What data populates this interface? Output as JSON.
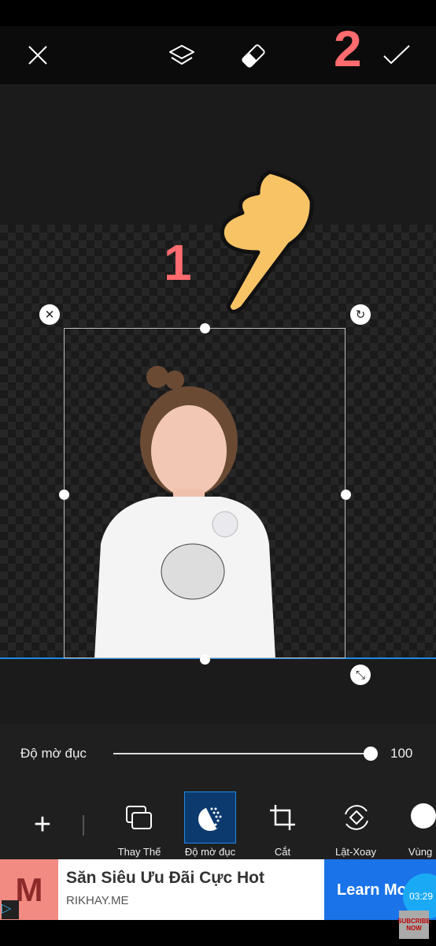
{
  "toolbar": {
    "close": "close-icon",
    "layers": "layers-icon",
    "eraser": "eraser-icon",
    "apply": "check-icon"
  },
  "annotations": {
    "step1": "1",
    "step2": "2"
  },
  "opacity": {
    "label": "Độ mờ đục",
    "value": "100",
    "percent": 100
  },
  "tools": [
    {
      "label": "Thay Thế",
      "icon": "replace-icon"
    },
    {
      "label": "Độ mờ đục",
      "icon": "opacity-icon",
      "selected": true
    },
    {
      "label": "Cắt",
      "icon": "crop-icon"
    },
    {
      "label": "Lật-Xoay",
      "icon": "flip-rotate-icon"
    },
    {
      "label": "Vùng",
      "icon": "region-icon"
    }
  ],
  "ad": {
    "logo": "M",
    "title": "Săn Siêu Ưu Đãi Cực Hot",
    "domain": "RIKHAY.ME",
    "cta": "Learn Mo",
    "timer": "03:29",
    "badge": "SUBCRIBE NOW"
  },
  "colors": {
    "accent": "#1e88e5",
    "annotation": "#ff6b6e",
    "selected_tool_bg": "#0d3a6e",
    "ad_cta": "#1a73e8",
    "ad_logo_bg": "#f28b82"
  }
}
